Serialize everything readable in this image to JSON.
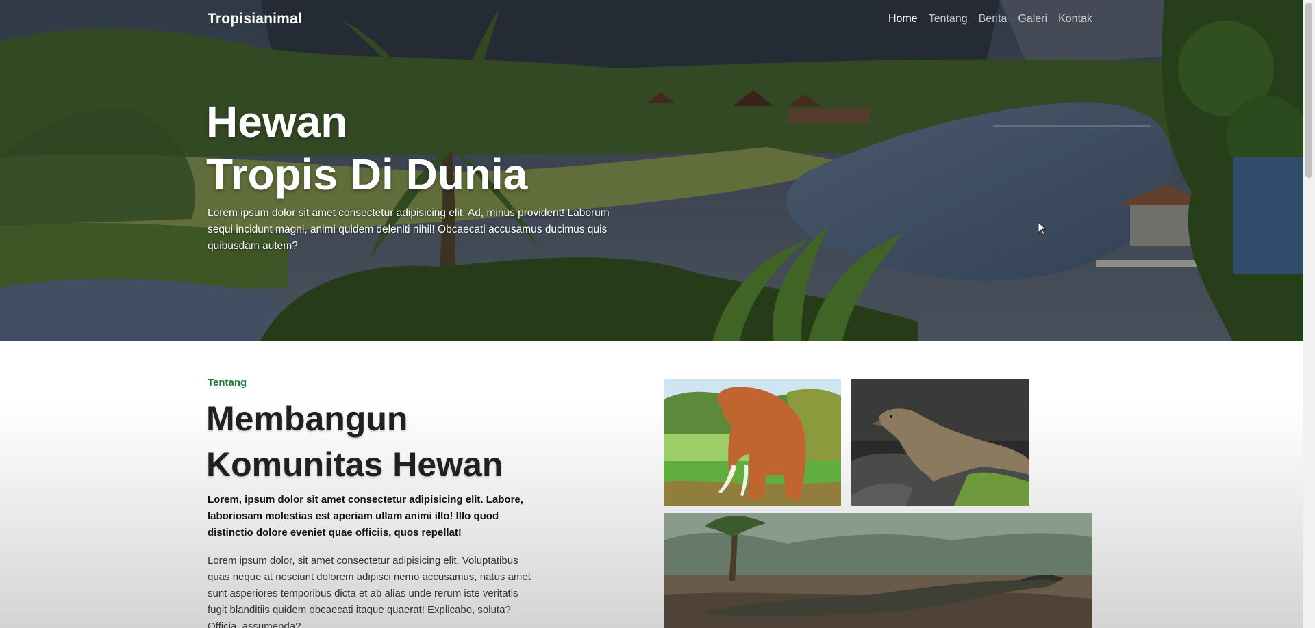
{
  "nav": {
    "brand": "Tropisianimal",
    "links": [
      {
        "label": "Home",
        "active": true
      },
      {
        "label": "Tentang",
        "active": false
      },
      {
        "label": "Berita",
        "active": false
      },
      {
        "label": "Galeri",
        "active": false
      },
      {
        "label": "Kontak",
        "active": false
      }
    ]
  },
  "hero": {
    "title_line1": "Hewan",
    "title_line2": "Tropis Di Dunia",
    "text": "Lorem ipsum dolor sit amet consectetur adipisicing elit. Ad, minus provident! Laborum sequi incidunt magni, animi quidem deleniti nihil! Obcaecati accusamus ducimus quis quibusdam autem?"
  },
  "about": {
    "label": "Tentang",
    "title_line1": "Membangun",
    "title_line2": "Komunitas Hewan",
    "lead": "Lorem, ipsum dolor sit amet consectetur adipisicing elit. Labore, laboriosam molestias est aperiam ullam animi illo! Illo quod distinctio dolore eveniet quae officiis, quos repellat!",
    "body": "Lorem ipsum dolor, sit amet consectetur adipisicing elit. Voluptatibus quas neque at nesciunt dolorem adipisci nemo accusamus, natus amet sunt asperiores temporibus dicta et ab alias unde rerum iste veritatis fugit blanditiis quidem obcaecati itaque quaerat! Explicabo, soluta? Officia, assumenda?"
  },
  "gallery": {
    "images": [
      "elephant",
      "komodo-dragon",
      "crocodile"
    ]
  },
  "colors": {
    "accent_green": "#1f7a34",
    "heading_dark": "#202020"
  }
}
